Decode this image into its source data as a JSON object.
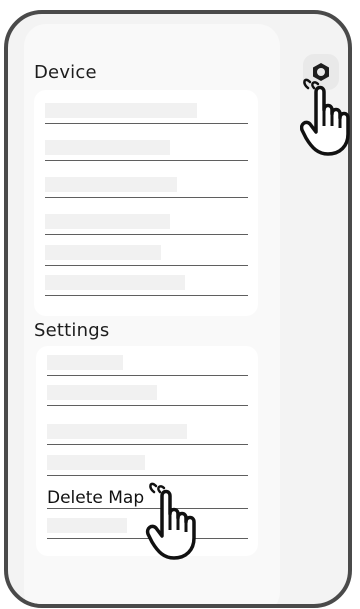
{
  "device_section": {
    "title": "Device",
    "rows": [
      {
        "placeholder": true,
        "fill": 0.78
      },
      {
        "placeholder": true,
        "fill": 0.61
      },
      {
        "placeholder": true,
        "fill": 0.65
      },
      {
        "placeholder": true,
        "fill": 0.61
      },
      {
        "placeholder": true,
        "fill": 0.57
      },
      {
        "placeholder": true,
        "fill": 0.68
      }
    ]
  },
  "settings_section": {
    "title": "Settings",
    "rows": [
      {
        "placeholder": true
      },
      {
        "placeholder": true
      },
      {
        "placeholder": true
      },
      {
        "placeholder": true
      },
      {
        "label": "Delete Map"
      },
      {
        "placeholder": true
      }
    ]
  },
  "icons": {
    "settings": "gear-icon",
    "pointer": "tap-hand-icon"
  },
  "colors": {
    "frame": "#4a4a4a",
    "screen": "#f3f3f3",
    "card": "#ffffff",
    "placeholder": "#f1f1f1",
    "divider": "#5f5f5f"
  }
}
